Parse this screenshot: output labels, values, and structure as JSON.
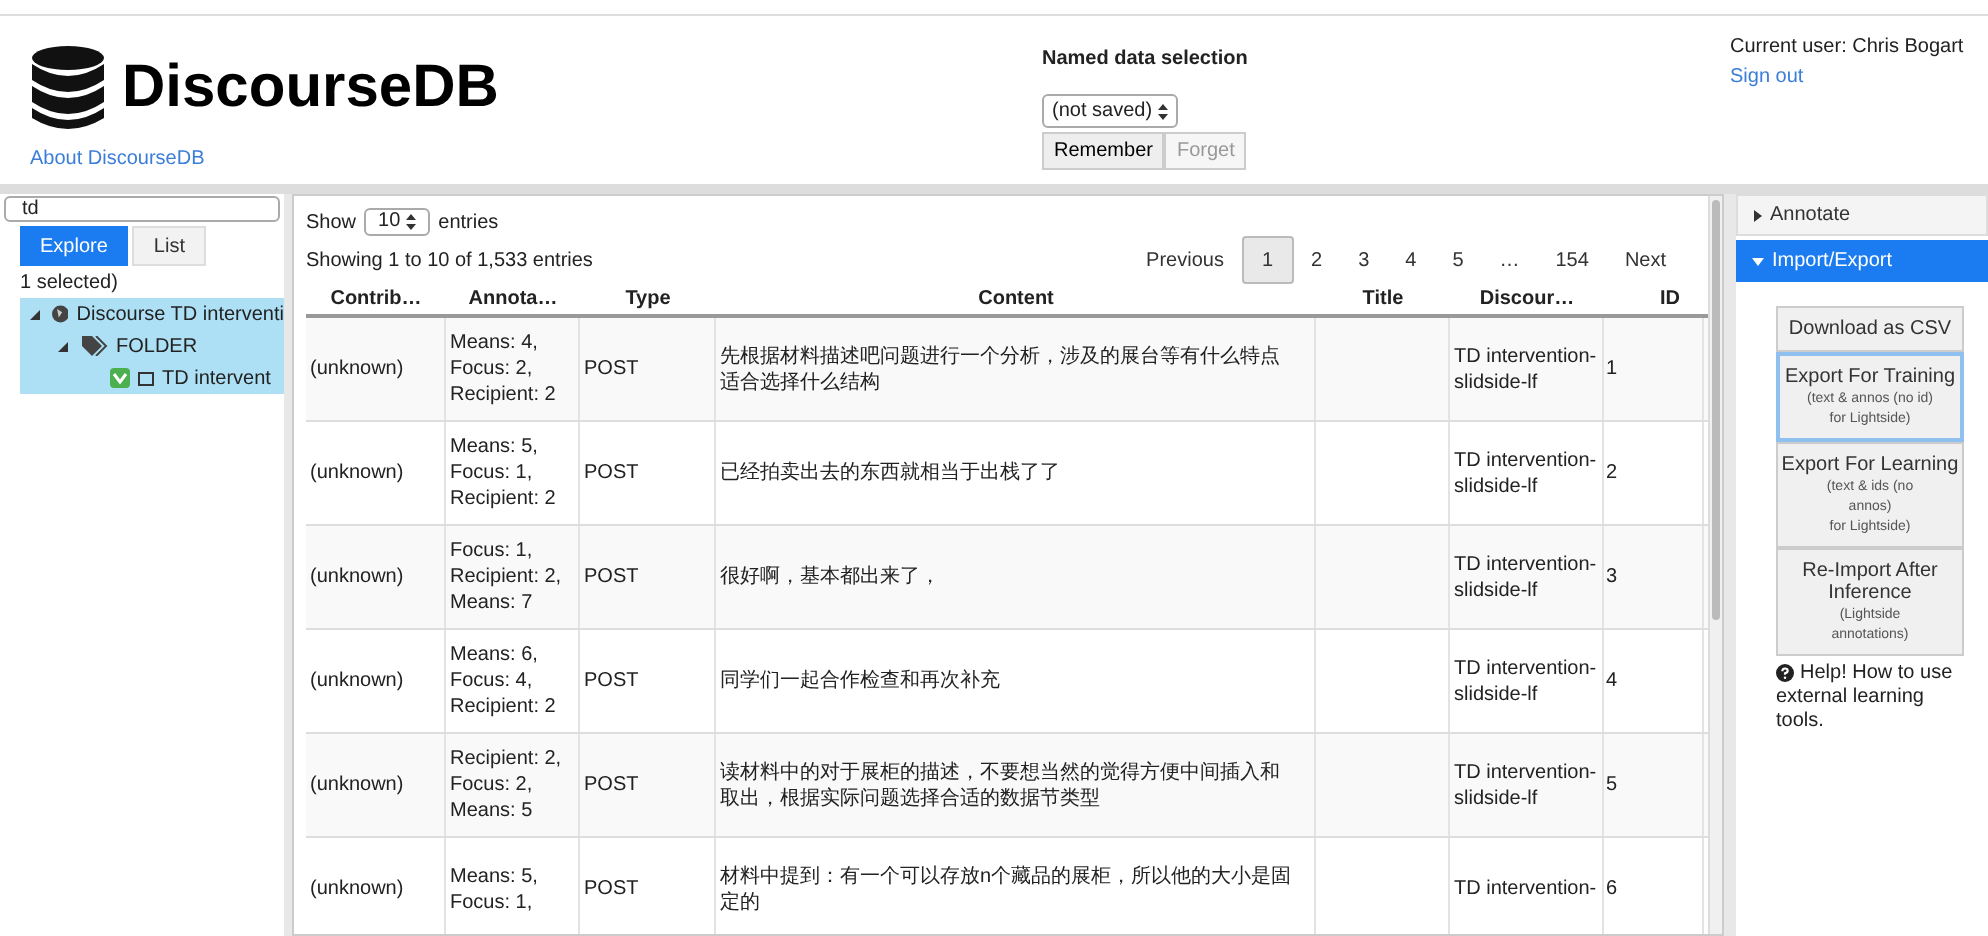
{
  "header": {
    "title": "DiscourseDB",
    "about_link": "About DiscourseDB",
    "named_selection": {
      "label": "Named data selection",
      "select_value": "(not saved)",
      "buttons": [
        {
          "label": "Remember",
          "disabled": false
        },
        {
          "label": "Forget",
          "disabled": true
        }
      ]
    },
    "user": {
      "current_user": "Current user: Chris Bogart",
      "sign_out": "Sign out"
    }
  },
  "sidebar": {
    "filter_value": "td",
    "tabs": [
      {
        "label": "Explore",
        "selected": true
      },
      {
        "label": "List",
        "selected": false
      }
    ],
    "selection_note": "1 selected)",
    "tree": [
      {
        "label": "Discourse TD interventi",
        "expanded": true,
        "selected": true,
        "children": [
          {
            "label": "FOLDER",
            "expanded": true,
            "selected": true,
            "children": [
              {
                "label": "TD intervent",
                "checked": true,
                "selected": true
              }
            ]
          }
        ]
      }
    ]
  },
  "table": {
    "show_label": "Show",
    "page_size": "10",
    "entries_label": "entries",
    "info": "Showing 1 to 10 of 1,533 entries",
    "pagination": [
      {
        "label": "Previous",
        "selected": false
      },
      {
        "label": "1",
        "selected": true
      },
      {
        "label": "2",
        "selected": false
      },
      {
        "label": "3",
        "selected": false
      },
      {
        "label": "4",
        "selected": false
      },
      {
        "label": "5",
        "selected": false
      },
      {
        "label": "…",
        "selected": false
      },
      {
        "label": "154",
        "selected": false
      },
      {
        "label": "Next",
        "selected": false
      }
    ],
    "columns": [
      "Contrib…",
      "Annota…",
      "Type",
      "Content",
      "Title",
      "Discour…",
      "ID"
    ],
    "rows": [
      [
        "(unknown)",
        "Means: 4,\nFocus: 2,\nRecipient: 2",
        "POST",
        "先根据材料描述吧问题进行一个分析，涉及的展台等有什么特点适合选择什么结构",
        "",
        "TD intervention-\nslidside-lf",
        "1"
      ],
      [
        "(unknown)",
        "Means: 5,\nFocus: 1,\nRecipient: 2",
        "POST",
        "已经拍卖出去的东西就相当于出栈了了",
        "",
        "TD intervention-\nslidside-lf",
        "2"
      ],
      [
        "(unknown)",
        "Focus: 1,\nRecipient: 2,\nMeans: 7",
        "POST",
        "很好啊，基本都出来了，",
        "",
        "TD intervention-\nslidside-lf",
        "3"
      ],
      [
        "(unknown)",
        "Means: 6,\nFocus: 4,\nRecipient: 2",
        "POST",
        "同学们一起合作检查和再次补充",
        "",
        "TD intervention-\nslidside-lf",
        "4"
      ],
      [
        "(unknown)",
        "Recipient: 2,\nFocus: 2,\nMeans: 5",
        "POST",
        "读材料中的对于展柜的描述，不要想当然的觉得方便中间插入和取出，根据实际问题选择合适的数据节类型",
        "",
        "TD intervention-\nslidside-lf",
        "5"
      ],
      [
        "(unknown)",
        "Means: 5,\nFocus: 1,",
        "POST",
        "材料中提到：有一个可以存放n个藏品的展柜，所以他的大小是固定的",
        "",
        "TD intervention-",
        "6"
      ]
    ]
  },
  "right_panel": {
    "sections": [
      {
        "label": "Annotate",
        "expanded": false
      },
      {
        "label": "Import/Export",
        "expanded": true
      }
    ],
    "buttons": [
      {
        "title": "Download as CSV",
        "focused": false
      },
      {
        "title": "Export For Training",
        "note": "(text & annos (no id)\nfor Lightside)",
        "focused": true
      },
      {
        "title": "Export For Learning",
        "note": "(text & ids (no\nannos)\nfor Lightside)",
        "focused": false
      },
      {
        "title": "Re-Import After Inference",
        "note": "(Lightside\nannotations)",
        "focused": false
      }
    ],
    "help_text": "Help! How to use external learning tools."
  }
}
